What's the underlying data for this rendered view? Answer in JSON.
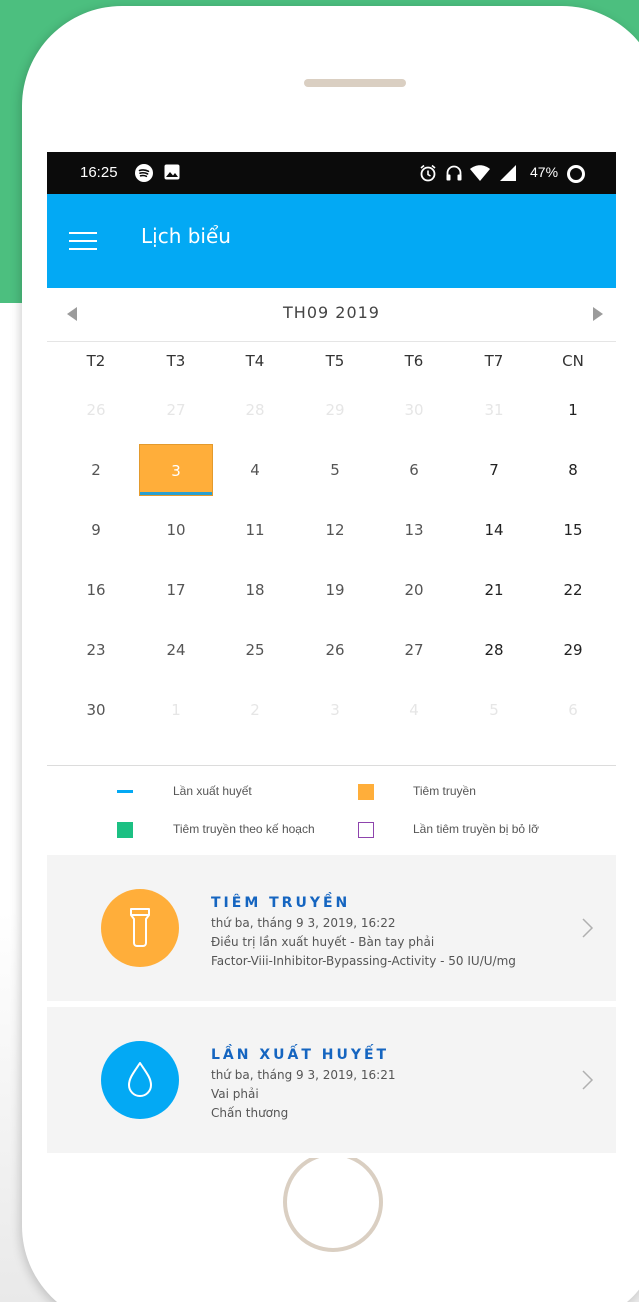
{
  "status": {
    "time": "16:25",
    "battery": "47%"
  },
  "appbar": {
    "title": "Lịch biểu"
  },
  "calendar": {
    "month_label": "TH09 2019",
    "weekdays": [
      "T2",
      "T3",
      "T4",
      "T5",
      "T6",
      "T7",
      "CN"
    ],
    "days": [
      {
        "n": "26",
        "muted": true
      },
      {
        "n": "27",
        "muted": true
      },
      {
        "n": "28",
        "muted": true
      },
      {
        "n": "29",
        "muted": true
      },
      {
        "n": "30",
        "muted": true
      },
      {
        "n": "31",
        "muted": true
      },
      {
        "n": "1"
      },
      {
        "n": "2"
      },
      {
        "n": "3",
        "selected": true
      },
      {
        "n": "4"
      },
      {
        "n": "5"
      },
      {
        "n": "6"
      },
      {
        "n": "7"
      },
      {
        "n": "8"
      },
      {
        "n": "9"
      },
      {
        "n": "10"
      },
      {
        "n": "11"
      },
      {
        "n": "12"
      },
      {
        "n": "13"
      },
      {
        "n": "14"
      },
      {
        "n": "15"
      },
      {
        "n": "16"
      },
      {
        "n": "17"
      },
      {
        "n": "18"
      },
      {
        "n": "19"
      },
      {
        "n": "20"
      },
      {
        "n": "21"
      },
      {
        "n": "22"
      },
      {
        "n": "23"
      },
      {
        "n": "24"
      },
      {
        "n": "25"
      },
      {
        "n": "26"
      },
      {
        "n": "27"
      },
      {
        "n": "28"
      },
      {
        "n": "29"
      },
      {
        "n": "30"
      },
      {
        "n": "1",
        "muted": true
      },
      {
        "n": "2",
        "muted": true
      },
      {
        "n": "3",
        "muted": true
      },
      {
        "n": "4",
        "muted": true
      },
      {
        "n": "5",
        "muted": true
      },
      {
        "n": "6",
        "muted": true
      }
    ]
  },
  "legend": {
    "bleed": "Lần xuất huyết",
    "infusion": "Tiêm truyền",
    "planned": "Tiêm truyền theo kế hoạch",
    "missed": "Lần tiêm truyền bị bỏ lỡ"
  },
  "events": [
    {
      "title": "TIÊM TRUYỀN",
      "date": "thứ ba, tháng 9 3, 2019, 16:22",
      "line2": "Điều trị lần xuất huyết - Bàn tay phải",
      "line3": "Factor-Viii-Inhibitor-Bypassing-Activity - 50 IU/U/mg",
      "icon": "vial-icon",
      "color": "#ffae3a"
    },
    {
      "title": "LẦN XUẤT HUYẾT",
      "date": "thứ ba, tháng 9 3, 2019, 16:21",
      "line2": "Vai phải",
      "line3": "Chấn thương",
      "icon": "drop-icon",
      "color": "#03a9f4"
    }
  ],
  "colors": {
    "accent": "#03a9f4",
    "infusion": "#ffae3a",
    "planned": "#1cc083",
    "missed": "#8e44ad",
    "background_green": "#4cbf7f"
  }
}
